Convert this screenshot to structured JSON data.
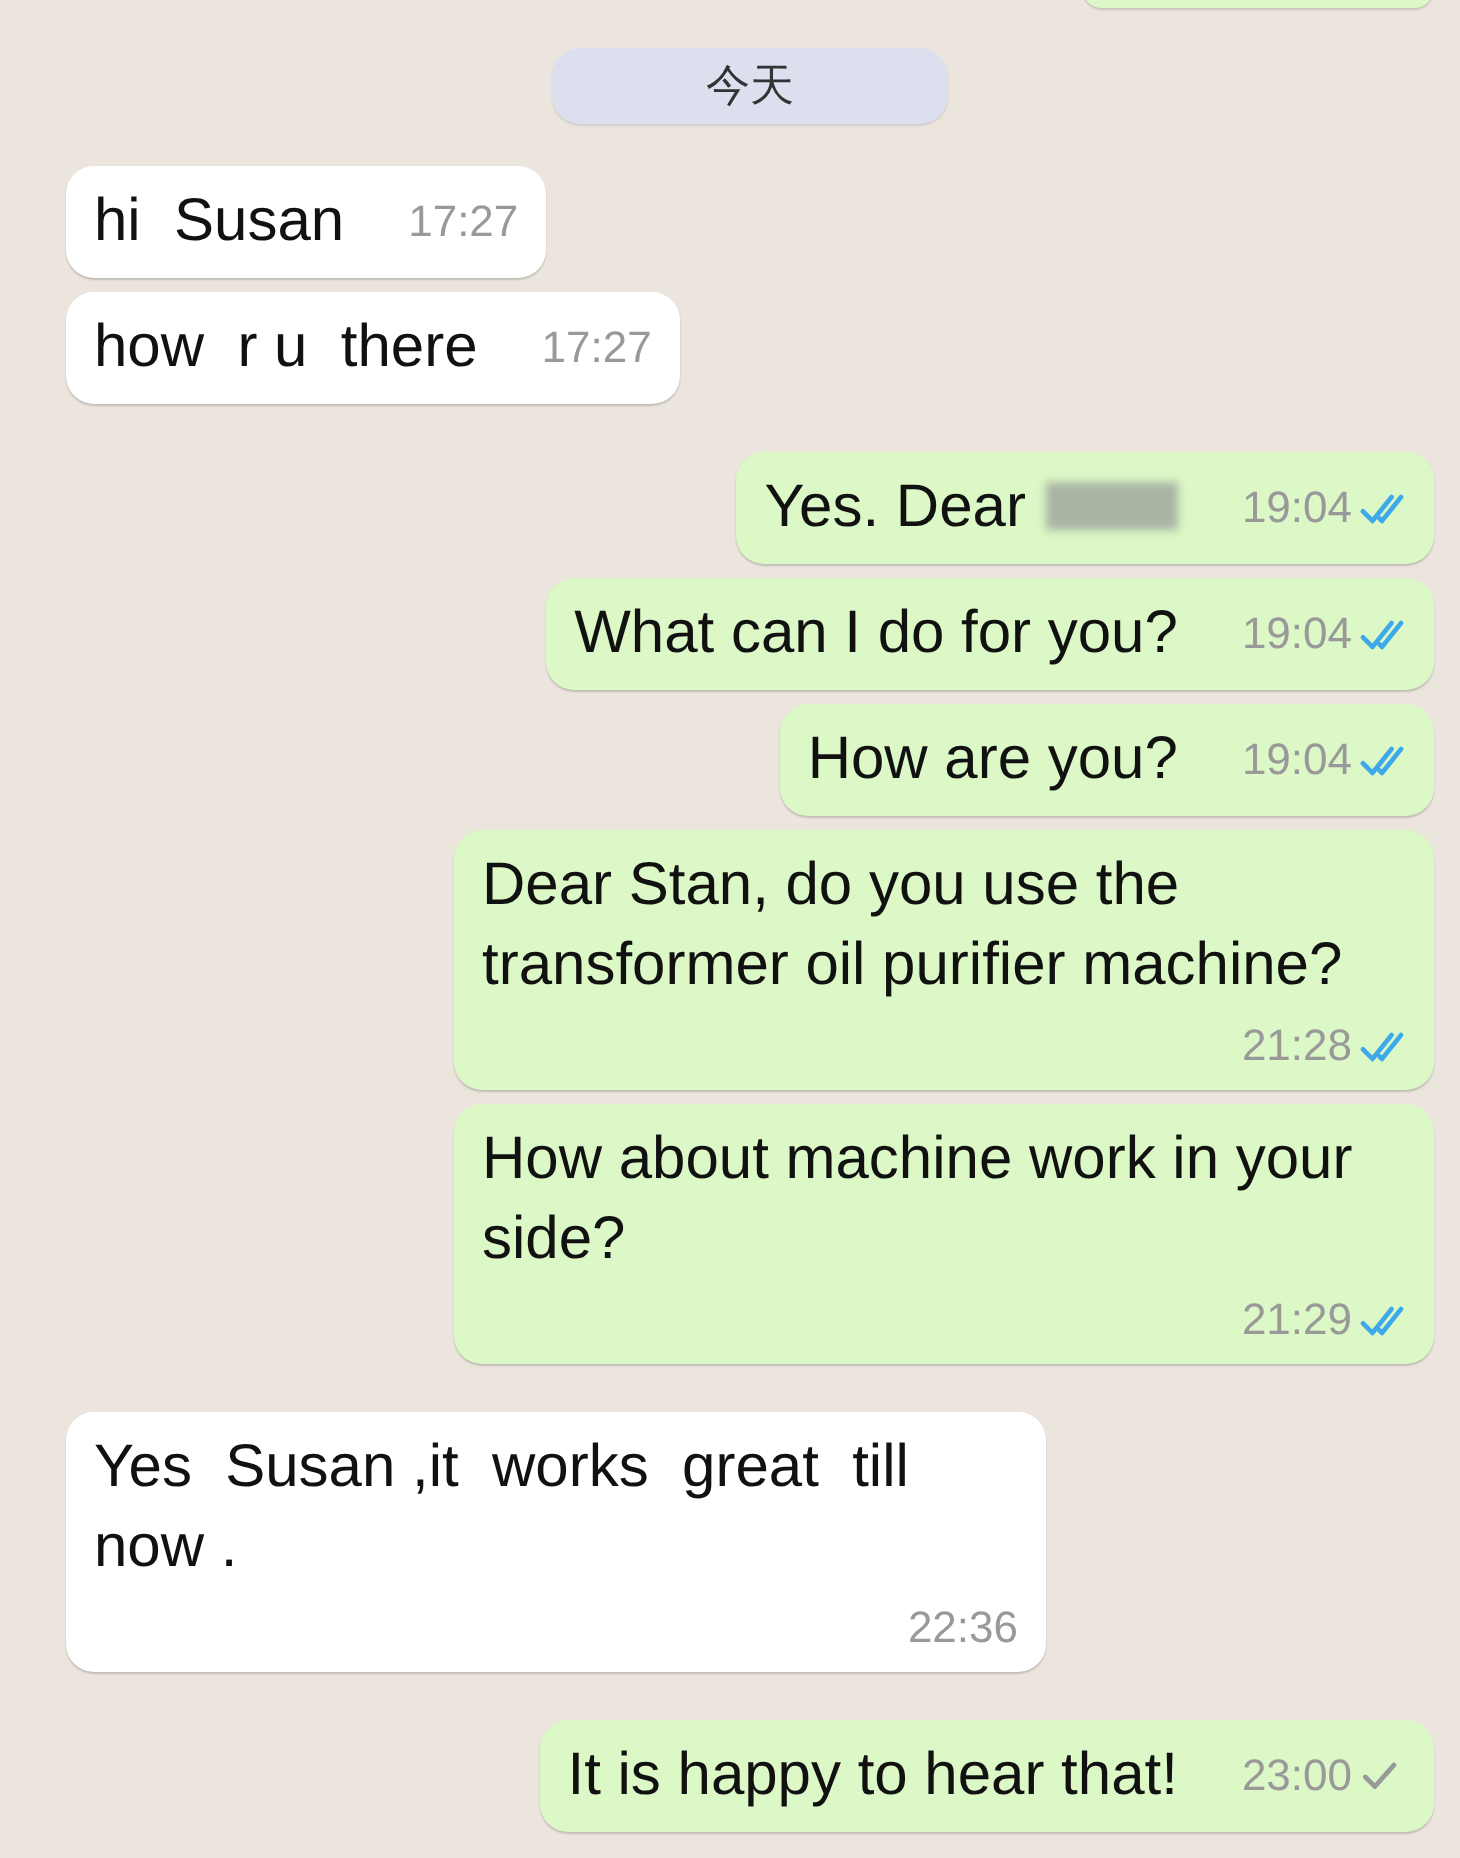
{
  "date_divider": "今天",
  "messages": [
    {
      "kind": "incoming",
      "text": "hi  Susan",
      "time": "17:27",
      "blurred": false
    },
    {
      "kind": "incoming",
      "text": "how  r u  there",
      "time": "17:27",
      "blurred": false
    },
    {
      "kind": "outgoing",
      "text": "Yes. Dear",
      "time": "19:04",
      "read": true,
      "blurred": true
    },
    {
      "kind": "outgoing",
      "text": "What can I do for you?",
      "time": "19:04",
      "read": true,
      "blurred": false
    },
    {
      "kind": "outgoing",
      "text": "How are you?",
      "time": "19:04",
      "read": true,
      "blurred": false
    },
    {
      "kind": "outgoing",
      "text": "Dear Stan, do you use the transformer oil purifier machine?",
      "time": "21:28",
      "read": true,
      "blurred": false
    },
    {
      "kind": "outgoing",
      "text": "How about machine work in your side?",
      "time": "21:29",
      "read": true,
      "blurred": false
    },
    {
      "kind": "incoming",
      "text": "Yes  Susan ,it  works  great  till now .",
      "time": "22:36",
      "blurred": false
    },
    {
      "kind": "outgoing",
      "text": "It is happy to hear that!",
      "time": "23:00",
      "read": false,
      "blurred": false
    }
  ]
}
